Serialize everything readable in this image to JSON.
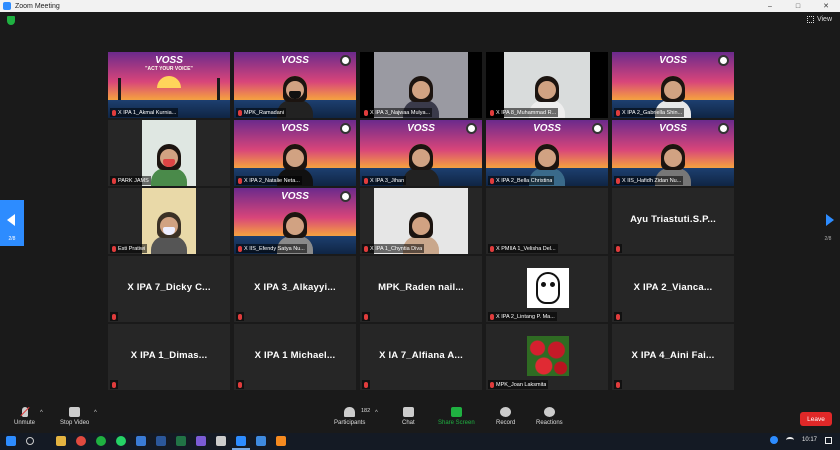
{
  "window": {
    "title": "Zoom Meeting",
    "controls": [
      "–",
      "□",
      "✕"
    ]
  },
  "view_button": {
    "label": "View"
  },
  "pager": {
    "left": "2/8",
    "right": "2/8"
  },
  "tiles": [
    {
      "label": "X IPA 1_Akmal Kurnia..."
    },
    {
      "label": "MPK_Ramadani"
    },
    {
      "label": "X IPA 3_Najwaa Mulya..."
    },
    {
      "label": "X IPA 8_Muhammad R..."
    },
    {
      "label": "X IPA 2_Gabriella Shin..."
    },
    {
      "label": "PARK JAMS"
    },
    {
      "label": "X IPA 2_Natalie Neta..."
    },
    {
      "label": "X IPA 3_Jihan"
    },
    {
      "label": "X IPA 2_Bella Christina"
    },
    {
      "label": "X IIS_Hafidh Zidan Nu..."
    },
    {
      "label": "Esti Pratiwi"
    },
    {
      "label": "X IIS_Efendy Satya Nu..."
    },
    {
      "label": "X IPA 1_Chyntia Diva"
    },
    {
      "label": "X PMIIA 1_Velisha Del..."
    },
    {
      "label": "",
      "big": "Ayu Triastuti.S.P..."
    },
    {
      "label": "",
      "big": "X IPA 7_Dicky C..."
    },
    {
      "label": "",
      "big": "X IPA 3_Alkayyi..."
    },
    {
      "label": "",
      "big": "MPK_Raden nail..."
    },
    {
      "label": "X IPA 2_Lintang P. Ma..."
    },
    {
      "label": "",
      "big": "X IPA 2_Vianca..."
    },
    {
      "label": "",
      "big": "X IPA 1_Dimas..."
    },
    {
      "label": "",
      "big": "X IPA 1 Michael..."
    },
    {
      "label": "",
      "big": "X IA 7_Alfiana A..."
    },
    {
      "label": "MPK_Joan Laksmita"
    },
    {
      "label": "",
      "big": "X IPA 4_Aini Fai..."
    }
  ],
  "voss": {
    "title": "VOSS",
    "tagline": "\"ACT YOUR VOICE\""
  },
  "toolbar": {
    "unmute": "Unmute",
    "stop_video": "Stop Video",
    "participants": "Participants",
    "participants_count": "182",
    "chat": "Chat",
    "share_screen": "Share Screen",
    "record": "Record",
    "reactions": "Reactions",
    "leave": "Leave"
  },
  "taskbar": {
    "time": "10:17"
  }
}
